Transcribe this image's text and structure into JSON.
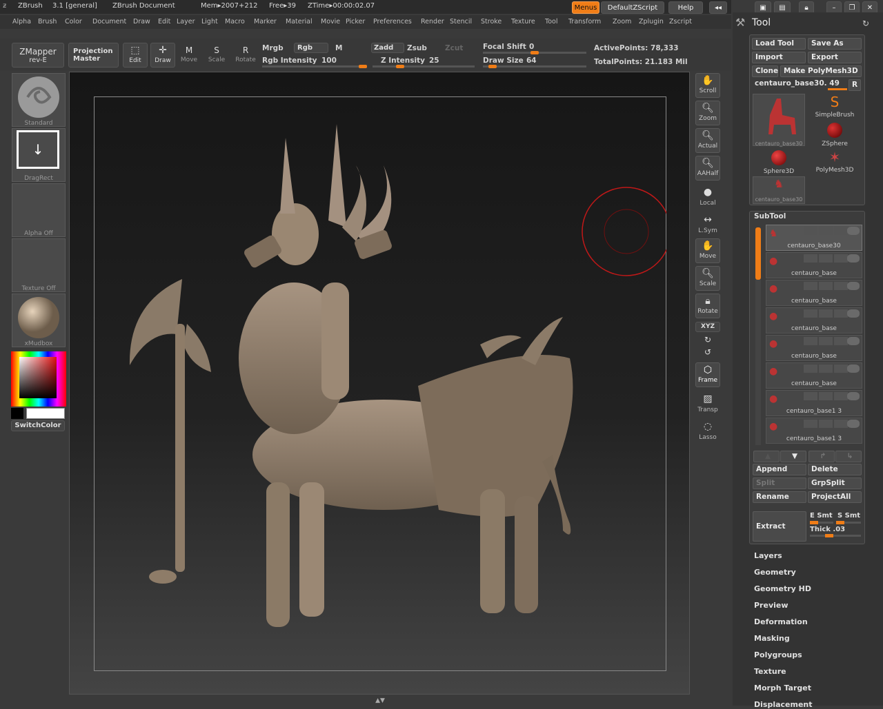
{
  "titlebar": {
    "app": "ZBrush",
    "version": "3.1 [general]",
    "document": "ZBrush Document",
    "mem": "Mem▸2007+212",
    "free": "Free▸39",
    "ztime": "ZTime▸00:00:02.07",
    "menus_btn": "Menus",
    "script_btn": "DefaultZScript",
    "help_btn": "Help"
  },
  "menus": [
    "Alpha",
    "Brush",
    "Color",
    "Document",
    "Draw",
    "Edit",
    "Layer",
    "Light",
    "Macro",
    "Marker",
    "Material",
    "Movie",
    "Picker",
    "Preferences",
    "Render",
    "Stencil",
    "Stroke",
    "Texture",
    "Tool",
    "Transform",
    "Zoom",
    "Zplugin",
    "Zscript"
  ],
  "shelf": {
    "zmapper": "ZMapper",
    "zmapper_sub": "rev-E",
    "projection": "Projection",
    "projection_sub": "Master",
    "edit": "Edit",
    "draw": "Draw",
    "move": "Move",
    "scale": "Scale",
    "rotate": "Rotate",
    "mrgb": "Mrgb",
    "rgb": "Rgb",
    "m": "M",
    "rgb_intensity_label": "Rgb Intensity",
    "rgb_intensity": "100",
    "zadd": "Zadd",
    "zsub": "Zsub",
    "zcut": "Zcut",
    "z_intensity_label": "Z Intensity",
    "z_intensity": "25",
    "focal_shift_label": "Focal Shift",
    "focal_shift": "0",
    "draw_size_label": "Draw Size",
    "draw_size": "64",
    "active_points": "ActivePoints: 78,333",
    "total_points": "TotalPoints: 21.183 Mil",
    "rgb_intensity_fraction": 1.0,
    "z_intensity_fraction": 0.25,
    "focal_shift_fraction": 0.5,
    "draw_size_fraction": 0.06
  },
  "left": {
    "standard": "Standard",
    "dragrect": "DragRect",
    "alpha": "Alpha  Off",
    "texture": "Texture  Off",
    "material": "xMudbox",
    "switchcolor": "SwitchColor"
  },
  "righttools": [
    "Scroll",
    "Zoom",
    "Actual",
    "AAHalf",
    "Local",
    "L.Sym",
    "Move",
    "Scale",
    "Rotate",
    "Frame",
    "Transp",
    "Lasso"
  ],
  "xyz_btn": "XYZ",
  "toolpanel": {
    "title": "Tool",
    "load": "Load Tool",
    "save": "Save As",
    "import": "Import",
    "export": "Export",
    "clone": "Clone",
    "make": "Make PolyMesh3D",
    "current": "centauro_base30. 49",
    "r": "R",
    "slots": [
      "centauro_base30",
      "SimpleBrush",
      "ZSphere",
      "Sphere3D",
      "PolyMesh3D",
      "centauro_base30"
    ],
    "subtool_title": "SubTool",
    "subtools": [
      "centauro_base30",
      "centauro_base",
      "centauro_base",
      "centauro_base",
      "centauro_base",
      "centauro_base",
      "centauro_base1 3",
      "centauro_base1 3"
    ],
    "append": "Append",
    "delete": "Delete",
    "split": "Split",
    "grpsplit": "GrpSplit",
    "rename": "Rename",
    "projectall": "ProjectAll",
    "extract": "Extract",
    "esmt": "E  Smt",
    "ssmt": "S  Smt",
    "thick": "Thick .03",
    "sections": [
      "Layers",
      "Geometry",
      "Geometry HD",
      "Preview",
      "Deformation",
      "Masking",
      "Polygroups",
      "Texture",
      "Morph Target",
      "Displacement"
    ]
  },
  "colors": {
    "accent": "#f07d17",
    "brush_ring": "#c01818"
  }
}
